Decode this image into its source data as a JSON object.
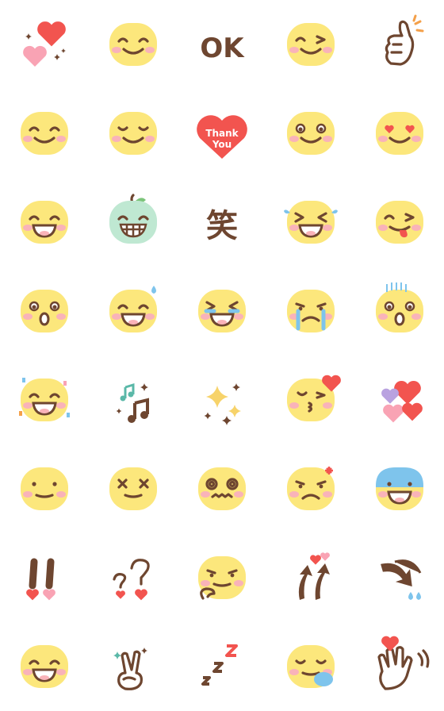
{
  "colors": {
    "face": "#FCE77C",
    "brown": "#6E4630",
    "cheek": "#F9B3B9",
    "red": "#F2544F",
    "pink": "#F9A3B4",
    "blue": "#7EC4EC",
    "green": "#BFE8D2",
    "gold": "#F7D36A"
  },
  "texts": {
    "ok": "OK",
    "thank": "Thank",
    "you": "You",
    "laugh": "笑"
  },
  "cells": [
    {
      "icon": "hearts-sparkle-icon"
    },
    {
      "icon": "smile-face-icon"
    },
    {
      "icon": "ok-text-icon",
      "text": "ok"
    },
    {
      "icon": "wink-face-icon"
    },
    {
      "icon": "thumbs-up-icon"
    },
    {
      "icon": "happy-face-icon"
    },
    {
      "icon": "content-face-icon"
    },
    {
      "icon": "thank-you-heart-icon"
    },
    {
      "icon": "sparkle-eyes-face-icon"
    },
    {
      "icon": "heart-eyes-face-icon"
    },
    {
      "icon": "laughing-face-icon"
    },
    {
      "icon": "apple-grin-face-icon"
    },
    {
      "icon": "laugh-kanji-icon",
      "text": "laugh"
    },
    {
      "icon": "tears-of-joy-face-icon"
    },
    {
      "icon": "tongue-wink-face-icon"
    },
    {
      "icon": "surprised-face-icon"
    },
    {
      "icon": "sweat-grin-face-icon"
    },
    {
      "icon": "loud-crying-face-icon"
    },
    {
      "icon": "crying-face-icon"
    },
    {
      "icon": "shocked-face-icon"
    },
    {
      "icon": "party-face-icon"
    },
    {
      "icon": "music-notes-icon"
    },
    {
      "icon": "sparkles-icon"
    },
    {
      "icon": "kiss-face-icon"
    },
    {
      "icon": "hearts-icon"
    },
    {
      "icon": "neutral-smile-face-icon"
    },
    {
      "icon": "x-eyes-face-icon"
    },
    {
      "icon": "dizzy-face-icon"
    },
    {
      "icon": "angry-face-icon"
    },
    {
      "icon": "blue-shock-face-icon"
    },
    {
      "icon": "exclamation-icon"
    },
    {
      "icon": "question-icon"
    },
    {
      "icon": "thinking-face-icon"
    },
    {
      "icon": "up-arrows-icon"
    },
    {
      "icon": "down-arrows-icon"
    },
    {
      "icon": "grin-face-icon"
    },
    {
      "icon": "peace-hand-icon"
    },
    {
      "icon": "zzz-icon"
    },
    {
      "icon": "sleeping-face-icon"
    },
    {
      "icon": "waving-hand-icon"
    }
  ]
}
